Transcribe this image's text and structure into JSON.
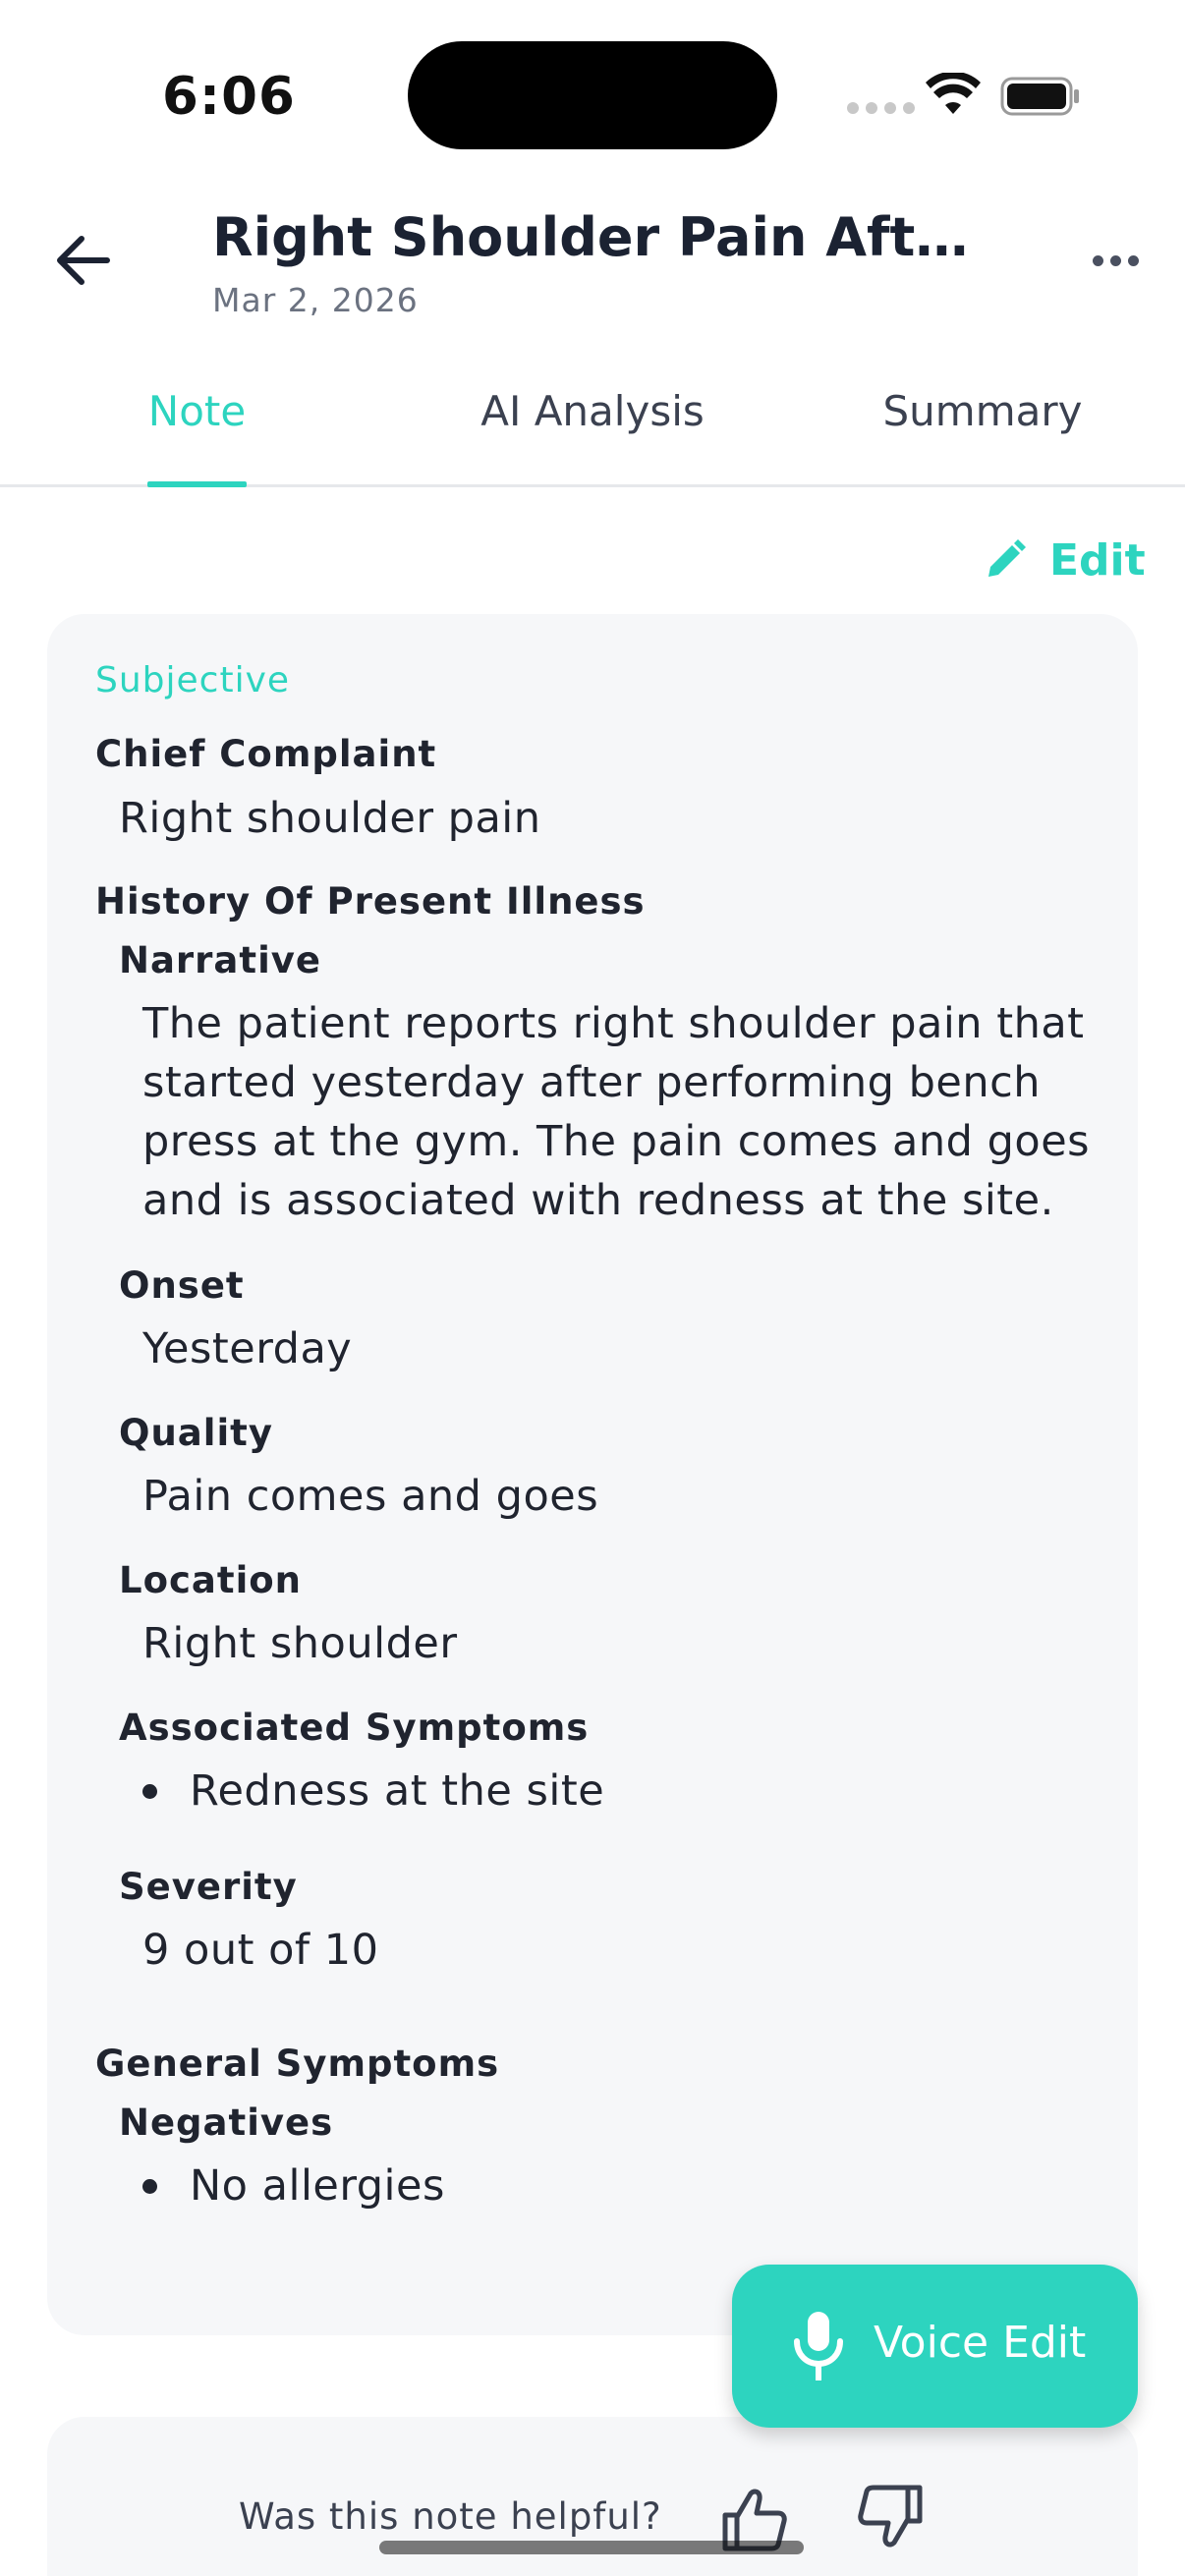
{
  "status_bar": {
    "time": "6:06"
  },
  "header": {
    "title": "Right Shoulder Pain After G…",
    "date": "Mar 2, 2026"
  },
  "tabs": [
    {
      "label": "Note",
      "active": true
    },
    {
      "label": "AI Analysis",
      "active": false
    },
    {
      "label": "Summary",
      "active": false
    }
  ],
  "edit_label": "Edit",
  "note": {
    "section_title": "Subjective",
    "chief_complaint": {
      "label": "Chief Complaint",
      "value": "Right shoulder pain"
    },
    "hpi": {
      "label": "History Of Present Illness",
      "narrative_label": "Narrative",
      "narrative": "The patient reports right shoulder pain that started yesterday after performing bench press at the gym. The pain comes and goes and is associated with redness at the site.",
      "onset_label": "Onset",
      "onset": "Yesterday",
      "quality_label": "Quality",
      "quality": "Pain comes and goes",
      "location_label": "Location",
      "location": "Right shoulder",
      "associated_label": "Associated Symptoms",
      "associated": [
        "Redness at the site"
      ],
      "severity_label": "Severity",
      "severity": "9 out of 10"
    },
    "general": {
      "label": "General Symptoms",
      "negatives_label": "Negatives",
      "negatives": [
        "No allergies"
      ]
    }
  },
  "voice_edit_label": "Voice Edit",
  "feedback": {
    "question": "Was this note helpful?"
  },
  "colors": {
    "accent": "#2dd4bf",
    "text": "#20242f",
    "card": "#f6f7f9"
  },
  "icons": [
    "back-arrow-icon",
    "more-icon",
    "pencil-icon",
    "microphone-icon",
    "thumbs-up-icon",
    "thumbs-down-icon",
    "wifi-icon",
    "battery-icon"
  ]
}
